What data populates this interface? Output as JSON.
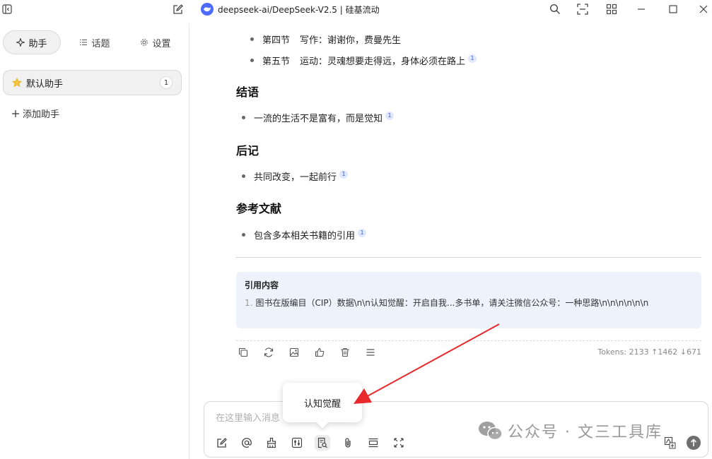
{
  "window": {
    "title": "deepseek-ai/DeepSeek-V2.5 | 硅基流动"
  },
  "sidebar": {
    "tabs": [
      {
        "label": "助手",
        "icon": "sparkle-icon",
        "active": true
      },
      {
        "label": "话题",
        "icon": "list-icon",
        "active": false
      },
      {
        "label": "设置",
        "icon": "gear-icon",
        "active": false
      }
    ],
    "assistant": {
      "label": "默认助手",
      "icon": "star-icon",
      "count": "1"
    },
    "add_assistant": {
      "icon": "plus",
      "label": "添加助手"
    }
  },
  "message": {
    "list_top": [
      {
        "section": "第四节",
        "text": "写作：谢谢你，费曼先生",
        "cite": ""
      },
      {
        "section": "第五节",
        "text": "运动：灵魂想要走得远，身体必须在路上",
        "cite": "1"
      }
    ],
    "sections": [
      {
        "heading": "结语",
        "item": "一流的生活不是富有，而是觉知",
        "cite": "1"
      },
      {
        "heading": "后记",
        "item": "共同改变，一起前行",
        "cite": "1"
      },
      {
        "heading": "参考文献",
        "item": "包含多本相关书籍的引用",
        "cite": "1"
      }
    ],
    "citations": {
      "title": "引用内容",
      "items": [
        {
          "num": "1.",
          "text": "图书在版编目（CIP）数据\\n\\n认知觉醒：开启自我...多书单，请关注微信公众号：一种思路\\n\\n\\n\\n\\n\\n"
        }
      ]
    },
    "tokens": "Tokens: 2133 ↑1462 ↓671"
  },
  "input": {
    "placeholder": "在这里输入消息",
    "tooltip": "认知觉醒"
  },
  "watermark": {
    "text": "公众号 · 文三工具库"
  },
  "colors": {
    "accent": "#4d6bfe",
    "annotation_arrow": "#e8282b",
    "quote_bg": "#eef3fb"
  }
}
